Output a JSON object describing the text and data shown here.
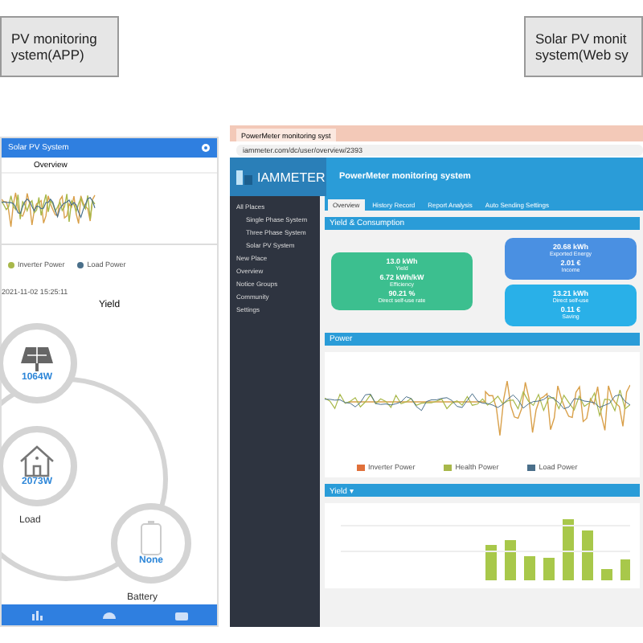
{
  "captions": [
    {
      "lines": [
        "PV monitoring",
        "ystem(APP)"
      ]
    },
    {
      "lines": [
        "Solar PV monit",
        "system(Web sy"
      ]
    }
  ],
  "app": {
    "title": "Solar PV System",
    "tab": "Overview",
    "legend": [
      {
        "label": "Inverter Power",
        "color": "#a8b84a"
      },
      {
        "label": "Load Power",
        "color": "#4a6f8a"
      }
    ],
    "timestamp": "2021-11-02 15:25:11",
    "yield_title": "Yield",
    "nodes": [
      {
        "kind": "solar",
        "value": "1064W"
      },
      {
        "kind": "house",
        "value": "2073W",
        "label": "Load"
      },
      {
        "kind": "battery",
        "value": "None",
        "label": "Battery"
      }
    ],
    "nav": [
      {
        "kind": "chart"
      },
      {
        "kind": "gauge"
      },
      {
        "kind": "box"
      }
    ]
  },
  "web": {
    "browser_tab": "PowerMeter monitoring syst",
    "address": "iammeter.com/dc/user/overview/2393",
    "logo": "IAMMETER",
    "header_title": "PowerMeter monitoring system",
    "sidebar": [
      {
        "label": "All Places",
        "children": [
          {
            "label": "Single Phase System"
          },
          {
            "label": "Three Phase System"
          },
          {
            "label": "Solar PV System"
          }
        ]
      },
      {
        "label": "New Place"
      },
      {
        "label": "Overview"
      },
      {
        "label": "Notice Groups"
      },
      {
        "label": "Community"
      },
      {
        "label": "Settings"
      }
    ],
    "tabs": [
      {
        "label": "Overview",
        "selected": true
      },
      {
        "label": "History Record",
        "selected": false
      },
      {
        "label": "Report Analysis",
        "selected": false
      },
      {
        "label": "Auto Sending Settings",
        "selected": false
      }
    ],
    "section_yield": "Yield & Consumption",
    "green_card": [
      {
        "value": "13.0 kWh",
        "label": "Yield"
      },
      {
        "value": "6.72 kWh/kW",
        "label": "Efficiency"
      },
      {
        "value": "90.21 %",
        "label": "Direct self-use rate"
      }
    ],
    "blue_cards": [
      {
        "items": [
          {
            "value": "20.68 kWh",
            "label": "Exported Energy"
          },
          {
            "value": "2.01 €",
            "label": "Income"
          }
        ],
        "color": "#4a90e2"
      },
      {
        "items": [
          {
            "value": "13.21 kWh",
            "label": "Direct self-use"
          },
          {
            "value": "0.11 €",
            "label": "Saving"
          }
        ],
        "color": "#29b0e8"
      }
    ],
    "section_power": "Power",
    "power_legend": [
      {
        "label": "Inverter Power",
        "color": "#e0703a"
      },
      {
        "label": "Health Power",
        "color": "#a8b84a"
      },
      {
        "label": "Load Power",
        "color": "#4a6f8a"
      }
    ],
    "section_bars": "Yield ▾"
  }
}
